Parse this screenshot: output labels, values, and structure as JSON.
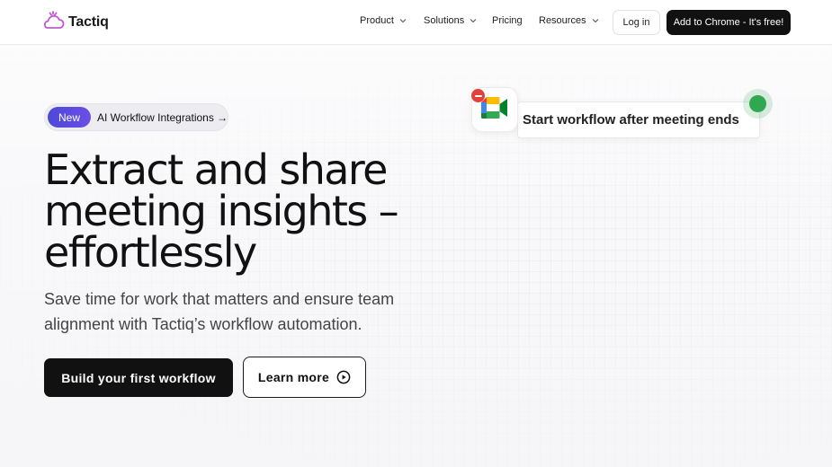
{
  "brand": {
    "name": "Tactiq",
    "logo_icon": "cloud-logo-icon",
    "logo_color": "#c05bd0"
  },
  "nav": {
    "items": [
      {
        "label": "Product",
        "has_dropdown": true
      },
      {
        "label": "Solutions",
        "has_dropdown": true
      },
      {
        "label": "Pricing",
        "has_dropdown": false
      },
      {
        "label": "Resources",
        "has_dropdown": true
      }
    ],
    "login_label": "Log in",
    "cta_label": "Add to Chrome - It's free!"
  },
  "hero": {
    "badge_new": "New",
    "badge_text": "AI Workflow Integrations →",
    "headline_lines": [
      "Extract and share",
      "meeting insights –",
      "effortlessly"
    ],
    "subtext_lines": [
      "Save time for work that matters and ensure team",
      "alignment with Tactiq’s workflow automation."
    ],
    "primary_button": "Build your first workflow",
    "secondary_button": "Learn more"
  },
  "workflow_card": {
    "label": "Start workflow after meeting ends",
    "app_icon": "google-meet-icon",
    "remove_icon": "remove-icon",
    "status_icon": "active-status-icon"
  },
  "colors": {
    "accent": "#5a4be0",
    "dark": "#111111",
    "status_green": "#2fa84f",
    "remove_red": "#e0423a"
  }
}
